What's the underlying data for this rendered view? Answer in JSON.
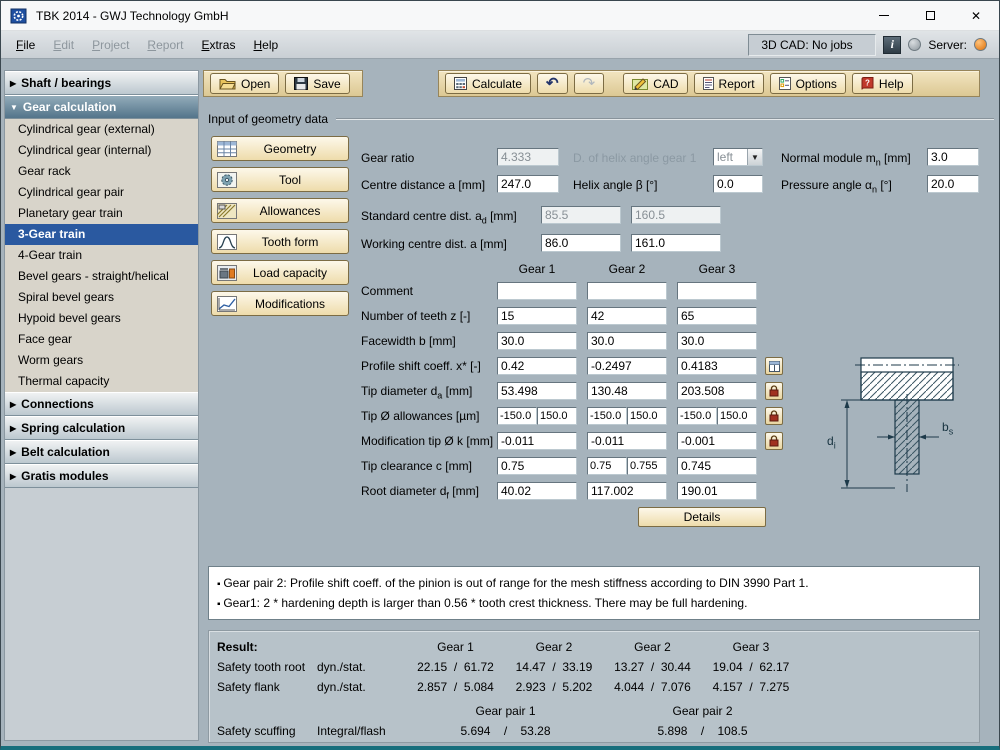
{
  "window": {
    "title": "TBK 2014 - GWJ Technology GmbH"
  },
  "menubar": {
    "items": [
      {
        "label": "File",
        "enabled": true
      },
      {
        "label": "Edit",
        "enabled": false
      },
      {
        "label": "Project",
        "enabled": false
      },
      {
        "label": "Report",
        "enabled": false
      },
      {
        "label": "Extras",
        "enabled": true
      },
      {
        "label": "Help",
        "enabled": true
      }
    ],
    "cad_status": "3D CAD: No jobs",
    "server_label": "Server:"
  },
  "sidebar": {
    "sections": [
      {
        "label": "Shaft / bearings"
      },
      {
        "label": "Gear calculation"
      },
      {
        "label": "Connections"
      },
      {
        "label": "Spring calculation"
      },
      {
        "label": "Belt calculation"
      },
      {
        "label": "Gratis modules"
      }
    ],
    "gear_items": [
      "Cylindrical gear (external)",
      "Cylindrical gear (internal)",
      "Gear rack",
      "Cylindrical gear pair",
      "Planetary gear train",
      "3-Gear train",
      "4-Gear train",
      "Bevel gears - straight/helical",
      "Spiral bevel gears",
      "Hypoid bevel gears",
      "Face gear",
      "Worm gears",
      "Thermal capacity"
    ],
    "selected_item": "3-Gear train"
  },
  "toolbar": {
    "open": "Open",
    "save": "Save",
    "calculate": "Calculate",
    "cad": "CAD",
    "report": "Report",
    "options": "Options",
    "help": "Help"
  },
  "section_title": "Input of geometry data",
  "nav_buttons": [
    "Geometry",
    "Tool",
    "Allowances",
    "Tooth form",
    "Load capacity",
    "Modifications"
  ],
  "form": {
    "gear_ratio_label": "Gear ratio",
    "gear_ratio": "4.333",
    "helix_dir_label": "D. of helix angle gear 1",
    "helix_dir": "left",
    "normal_module_pre": "Normal module m",
    "normal_module_sub": "n",
    "normal_module_post": " [mm]",
    "normal_module": "3.0",
    "centre_dist_label": "Centre distance a [mm]",
    "centre_dist": "247.0",
    "helix_angle_label": "Helix angle β [°]",
    "helix_angle": "0.0",
    "pressure_angle_pre": "Pressure angle α",
    "pressure_angle_sub": "n",
    "pressure_angle_post": " [°]",
    "pressure_angle": "20.0",
    "std_centre_pre": "Standard centre dist. a",
    "std_centre_sub": "d",
    "std_centre_post": " [mm]",
    "std_centre_1": "85.5",
    "std_centre_2": "160.5",
    "working_centre_label": "Working centre dist. a [mm]",
    "working_centre_1": "86.0",
    "working_centre_2": "161.0",
    "col_headers": [
      "Gear 1",
      "Gear 2",
      "Gear 3"
    ],
    "comment_label": "Comment",
    "comment": [
      "",
      "",
      ""
    ],
    "teeth_label": "Number of teeth z [-]",
    "teeth": [
      "15",
      "42",
      "65"
    ],
    "facewidth_label": "Facewidth b [mm]",
    "facewidth": [
      "30.0",
      "30.0",
      "30.0"
    ],
    "profile_shift_label": "Profile shift coeff. x* [-]",
    "profile_shift": [
      "0.42",
      "-0.2497",
      "0.4183"
    ],
    "tip_dia_pre": "Tip diameter d",
    "tip_dia_sub": "a",
    "tip_dia_post": " [mm]",
    "tip_dia": [
      "53.498",
      "130.48",
      "203.508"
    ],
    "tip_allow_label": "Tip Ø allowances [µm]",
    "tip_allow": [
      [
        "-150.0",
        "150.0"
      ],
      [
        "-150.0",
        "150.0"
      ],
      [
        "-150.0",
        "150.0"
      ]
    ],
    "mod_tip_label": "Modification tip Ø k [mm]",
    "mod_tip": [
      "-0.011",
      "-0.011",
      "-0.001"
    ],
    "tip_clear_label": "Tip clearance c [mm]",
    "tip_clear_1": "0.75",
    "tip_clear_2a": "0.75",
    "tip_clear_2b": "0.755",
    "tip_clear_3": "0.745",
    "root_dia_pre": "Root diameter d",
    "root_dia_sub": "f",
    "root_dia_post": " [mm]",
    "root_dia": [
      "40.02",
      "117.002",
      "190.01"
    ],
    "details": "Details"
  },
  "drawing": {
    "dim_di_pre": "d",
    "dim_di_sub": "i",
    "dim_bs_pre": "b",
    "dim_bs_sub": "s"
  },
  "warnings": [
    "Gear pair 2: Profile shift coeff. of the pinion is out of range for the mesh stiffness according to DIN 3990 Part 1.",
    "Gear1: 2 * hardening depth is larger than 0.56 * tooth crest thickness. There may be full hardening."
  ],
  "results": {
    "title": "Result:",
    "gear_headers": [
      "Gear 1",
      "Gear 2",
      "Gear 2",
      "Gear 3"
    ],
    "tooth_root": {
      "label": "Safety tooth root",
      "mode": "dyn./stat.",
      "values": [
        "22.15  /  61.72",
        "14.47  /  33.19",
        "13.27  /  30.44",
        "19.04  /  62.17"
      ]
    },
    "flank": {
      "label": "Safety flank",
      "mode": "dyn./stat.",
      "values": [
        "2.857  /  5.084",
        "2.923  /  5.202",
        "4.044  /  7.076",
        "4.157  /  7.275"
      ]
    },
    "pair_headers": [
      "Gear pair 1",
      "Gear pair 2"
    ],
    "scuffing": {
      "label": "Safety scuffing",
      "mode": "Integral/flash",
      "values": [
        "5.694    /    53.28",
        "5.898    /    108.5"
      ]
    }
  }
}
